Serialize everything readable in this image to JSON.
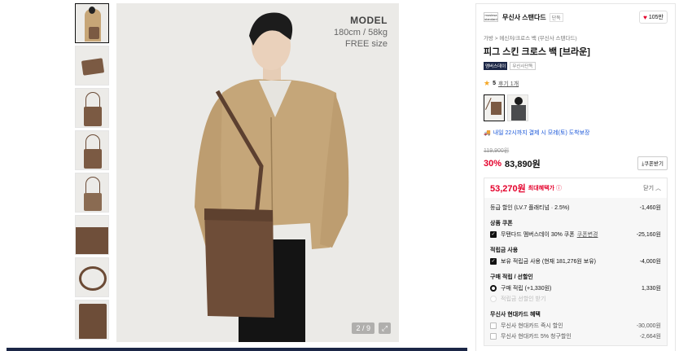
{
  "thumbnails": [
    "thumb-1",
    "thumb-2",
    "thumb-3",
    "thumb-4",
    "thumb-5",
    "thumb-6",
    "thumb-7",
    "thumb-8"
  ],
  "main_image": {
    "model_label": "MODEL",
    "model_size": "180cm / 58kg",
    "model_fit": "FREE size",
    "counter": "2 / 9"
  },
  "store": {
    "logo_text": "musinsa standard",
    "name": "무신사 스탠다드",
    "tag": "단독",
    "likes": "105만"
  },
  "breadcrumb": "가방 > 메신저/크로스 백 (무신사 스탠다드)",
  "product": {
    "title": "피그 스킨 크로스 백 [브라운]",
    "badge_dark": "멤버스데이",
    "badge_light": "무신사단독",
    "rating": "5",
    "reviews": "후기 1개",
    "delivery": "내일 22시까지 결제 시 모레(토) 도착보장",
    "original_price": "119,900원",
    "discount": "30%",
    "price": "83,890원",
    "coupon_button": "쿠폰받기"
  },
  "benefit_box": {
    "max_price": "53,270원",
    "max_label": "최대혜택가",
    "close_label": "닫기",
    "grade_label": "등급 할인 (LV.7 플래티넘 · 2.5%)",
    "grade_amount": "-1,460원",
    "coupon_section": "상품 쿠폰",
    "coupon_label": "무탠다드 멤버스데이 30% 쿠폰",
    "coupon_change": "쿠폰변경",
    "coupon_amount": "-25,160원",
    "points_section": "적립금 사용",
    "points_label": "보유 적립금 사용 (현재 181,276원 보유)",
    "points_amount": "-4,000원",
    "earn_section": "구매 적립 / 선할인",
    "earn_label": "구매 적립 (+1,330원)",
    "earn_amount": "1,330원",
    "prediscount_label": "적립금 선할인 받기",
    "card_section": "무신사 현대카드 혜택",
    "card1_label": "무신사 현대카드 즉시 할인",
    "card1_amount": "-30,000원",
    "card2_label": "무신사 현대카드 5% 청구할인",
    "card2_amount": "-2,664원"
  }
}
